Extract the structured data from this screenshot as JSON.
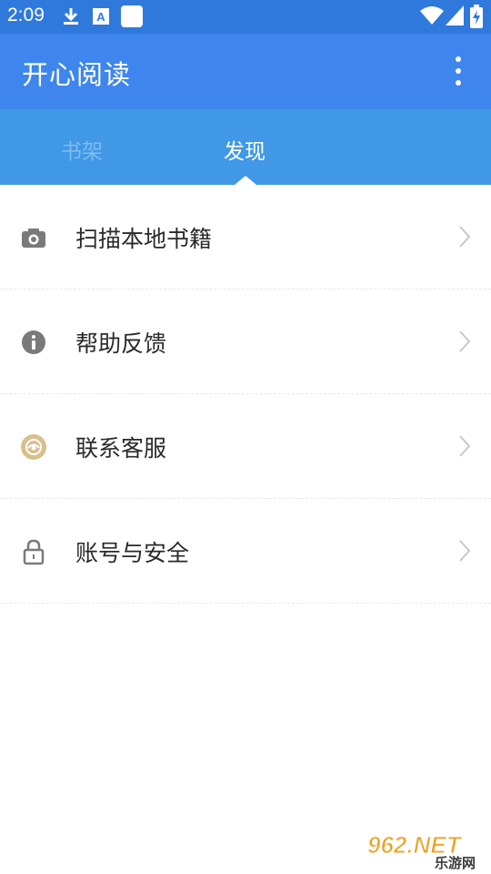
{
  "status_bar": {
    "time": "2:09",
    "icons": [
      "download-icon",
      "font-icon",
      "app-square-icon",
      "wifi-icon",
      "signal-icon",
      "battery-charging-icon"
    ]
  },
  "app_bar": {
    "title": "开心阅读",
    "menu_icon": "more-vertical-icon"
  },
  "tabs": [
    {
      "label": "书架",
      "selected": false
    },
    {
      "label": "发现",
      "selected": true
    }
  ],
  "menu": [
    {
      "label": "扫描本地书籍",
      "icon": "camera-icon"
    },
    {
      "label": "帮助反馈",
      "icon": "info-icon"
    },
    {
      "label": "联系客服",
      "icon": "customer-service-icon"
    },
    {
      "label": "账号与安全",
      "icon": "lock-icon"
    }
  ],
  "watermark": {
    "text": "962.NET",
    "subtext": "乐游网"
  },
  "colors": {
    "status_bar": "#2f79dc",
    "app_bar": "#3e86ee",
    "tab_bar": "#4098e6",
    "tab_inactive": "#7fbcf0",
    "icon_gray": "#7a7a7a",
    "icon_gold": "#d7bf8c"
  }
}
